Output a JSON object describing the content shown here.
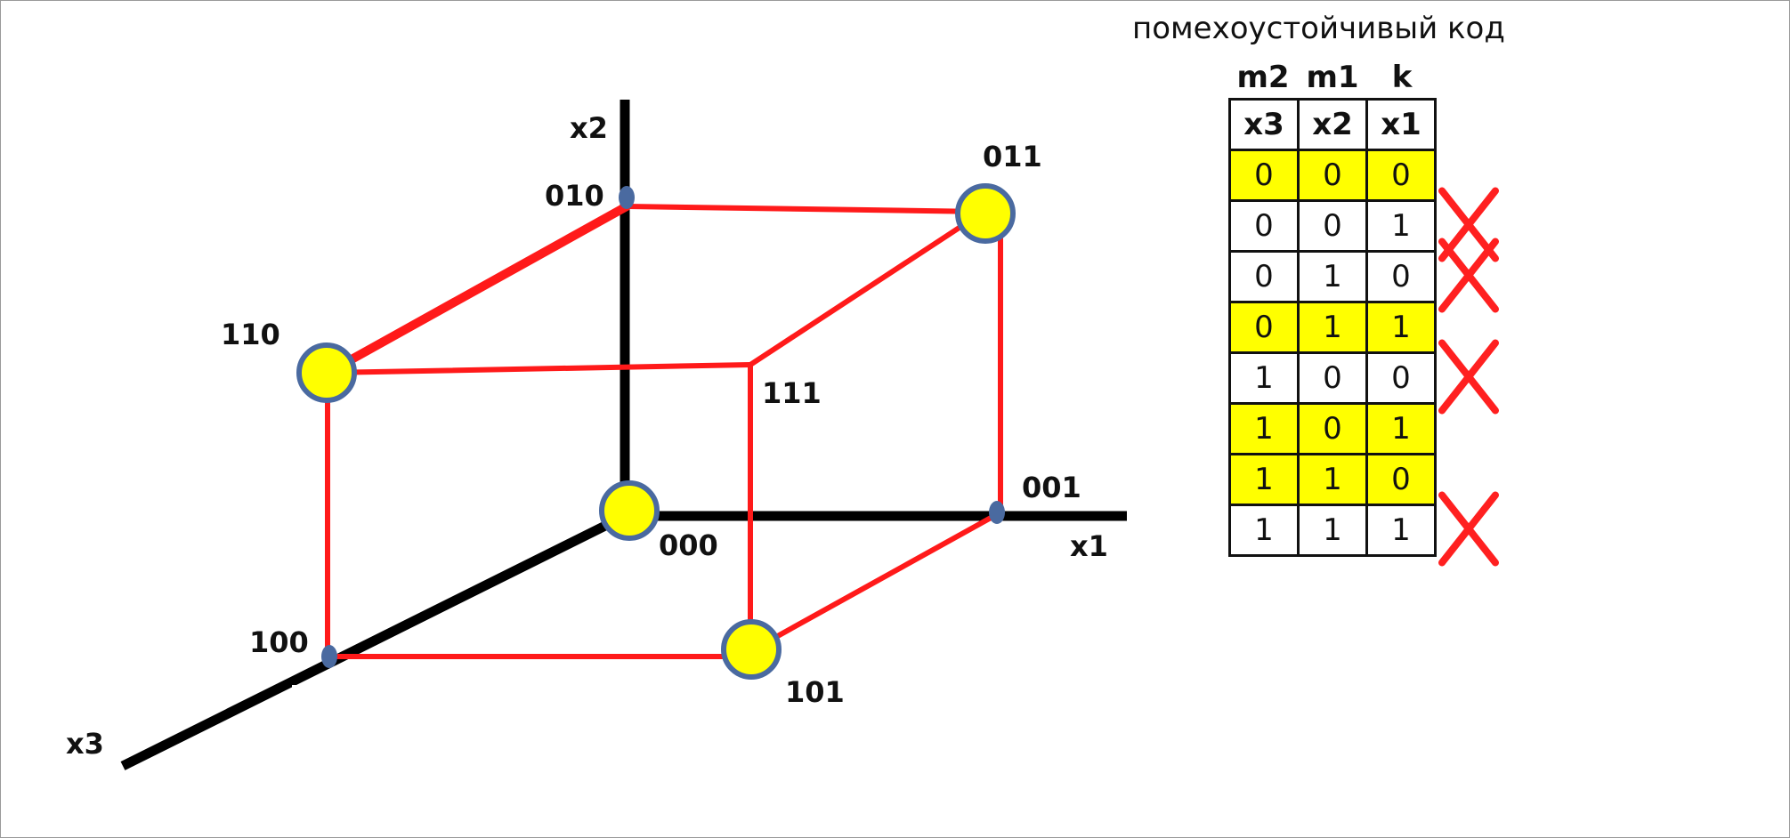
{
  "axes": {
    "x1": "x1",
    "x2": "x2",
    "x3": "x3"
  },
  "vertices": {
    "v000": "000",
    "v001": "001",
    "v010": "010",
    "v011": "011",
    "v100": "100",
    "v101": "101",
    "v110": "110",
    "v111": "111"
  },
  "code": {
    "title": "помехоустойчивый код",
    "column_captions": [
      "m2",
      "m1",
      "k"
    ],
    "headers": [
      "x3",
      "x2",
      "x1"
    ],
    "rows": [
      {
        "bits": [
          "0",
          "0",
          "0"
        ],
        "valid": true
      },
      {
        "bits": [
          "0",
          "0",
          "1"
        ],
        "valid": false
      },
      {
        "bits": [
          "0",
          "1",
          "0"
        ],
        "valid": false
      },
      {
        "bits": [
          "0",
          "1",
          "1"
        ],
        "valid": true
      },
      {
        "bits": [
          "1",
          "0",
          "0"
        ],
        "valid": false
      },
      {
        "bits": [
          "1",
          "0",
          "1"
        ],
        "valid": true
      },
      {
        "bits": [
          "1",
          "1",
          "0"
        ],
        "valid": true
      },
      {
        "bits": [
          "1",
          "1",
          "1"
        ],
        "valid": false
      }
    ]
  },
  "colors": {
    "edge": "#ff1a1a",
    "axis": "#000000",
    "selected_vertex_fill": "#ffff00",
    "vertex_outline": "#4a6aa0",
    "valid_row": "#ffff00",
    "cross": "#ff2020"
  }
}
